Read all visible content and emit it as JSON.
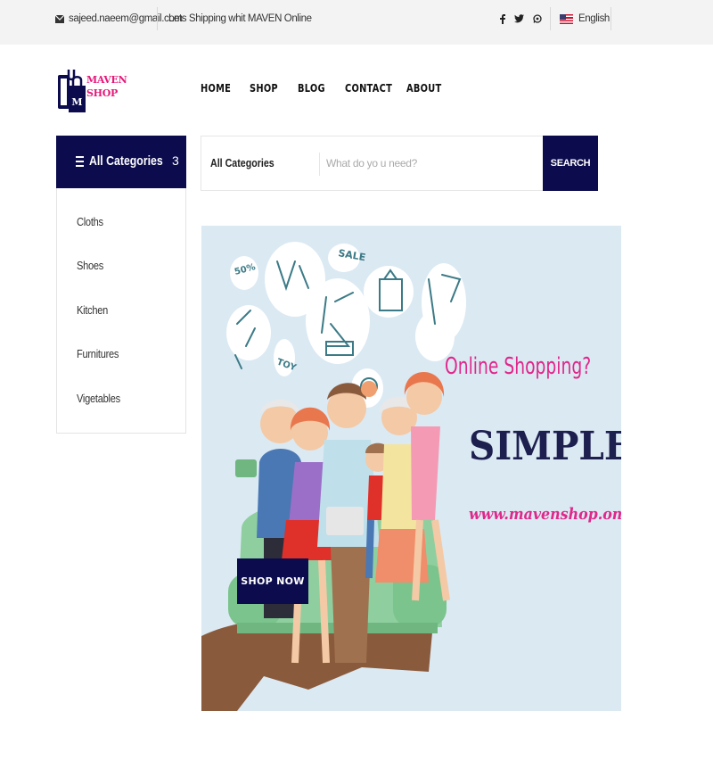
{
  "topbar": {
    "email": "sajeed.naeem@gmail.com",
    "tagline": "Lets Shipping whit MAVEN Online",
    "social_icons": [
      "facebook-icon",
      "twitter-icon",
      "whatsapp-icon"
    ],
    "language": "English"
  },
  "brand": {
    "line1": "MAVEN",
    "line2": "SHOP",
    "icon_letters": "M",
    "color": "#e5197a"
  },
  "nav": {
    "items": [
      "HOME",
      "SHOP",
      "BLOG",
      "CONTACT",
      "ABOUT"
    ]
  },
  "categories": {
    "title": "All Categories",
    "count": "3",
    "items": [
      "Cloths",
      "Shoes",
      "Kitchen",
      "Furnitures",
      "Vigetables"
    ]
  },
  "search": {
    "category_label": "All Categories",
    "placeholder": "What do yo u need?",
    "button_label": "SEARCH"
  },
  "banner": {
    "headline": "Online Shopping?",
    "headline2": "SIMPLE!",
    "url": "www.mavenshop.online",
    "cta_label": "SHOP NOW",
    "bubble_text": {
      "sale": "SALE",
      "percent": "50%",
      "toy": "TOY"
    }
  },
  "colors": {
    "primary": "#0b0b4d",
    "accent": "#e0278a",
    "banner_bg": "#dbe9f3"
  }
}
